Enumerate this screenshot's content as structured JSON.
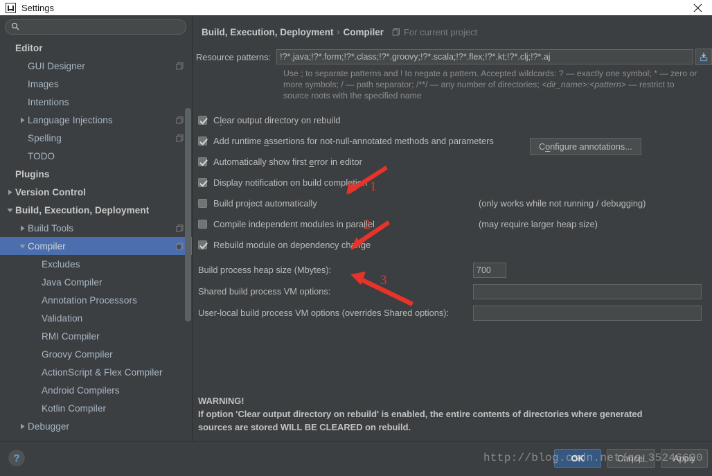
{
  "window": {
    "title": "Settings",
    "app_icon": "intellij-idea-icon",
    "close_icon": "close-icon"
  },
  "sidebar": {
    "search": {
      "value": "",
      "placeholder": "",
      "icon": "search-icon"
    },
    "items": [
      {
        "label": "Editor",
        "indent": 0,
        "bold": true,
        "twisty": "none",
        "copy": false,
        "selected": false
      },
      {
        "label": "GUI Designer",
        "indent": 1,
        "bold": false,
        "twisty": "none",
        "copy": true,
        "selected": false
      },
      {
        "label": "Images",
        "indent": 1,
        "bold": false,
        "twisty": "none",
        "copy": false,
        "selected": false
      },
      {
        "label": "Intentions",
        "indent": 1,
        "bold": false,
        "twisty": "none",
        "copy": false,
        "selected": false
      },
      {
        "label": "Language Injections",
        "indent": 1,
        "bold": false,
        "twisty": "collapsed",
        "copy": true,
        "selected": false
      },
      {
        "label": "Spelling",
        "indent": 1,
        "bold": false,
        "twisty": "none",
        "copy": true,
        "selected": false
      },
      {
        "label": "TODO",
        "indent": 1,
        "bold": false,
        "twisty": "none",
        "copy": false,
        "selected": false
      },
      {
        "label": "Plugins",
        "indent": 0,
        "bold": true,
        "twisty": "none",
        "copy": false,
        "selected": false
      },
      {
        "label": "Version Control",
        "indent": 0,
        "bold": true,
        "twisty": "collapsed",
        "copy": false,
        "selected": false
      },
      {
        "label": "Build, Execution, Deployment",
        "indent": 0,
        "bold": true,
        "twisty": "expanded",
        "copy": false,
        "selected": false
      },
      {
        "label": "Build Tools",
        "indent": 1,
        "bold": false,
        "twisty": "collapsed",
        "copy": true,
        "selected": false
      },
      {
        "label": "Compiler",
        "indent": 1,
        "bold": false,
        "twisty": "expanded",
        "copy": true,
        "selected": true
      },
      {
        "label": "Excludes",
        "indent": 2,
        "bold": false,
        "twisty": "none",
        "copy": false,
        "selected": false
      },
      {
        "label": "Java Compiler",
        "indent": 2,
        "bold": false,
        "twisty": "none",
        "copy": false,
        "selected": false
      },
      {
        "label": "Annotation Processors",
        "indent": 2,
        "bold": false,
        "twisty": "none",
        "copy": false,
        "selected": false
      },
      {
        "label": "Validation",
        "indent": 2,
        "bold": false,
        "twisty": "none",
        "copy": false,
        "selected": false
      },
      {
        "label": "RMI Compiler",
        "indent": 2,
        "bold": false,
        "twisty": "none",
        "copy": false,
        "selected": false
      },
      {
        "label": "Groovy Compiler",
        "indent": 2,
        "bold": false,
        "twisty": "none",
        "copy": false,
        "selected": false
      },
      {
        "label": "ActionScript & Flex Compiler",
        "indent": 2,
        "bold": false,
        "twisty": "none",
        "copy": false,
        "selected": false
      },
      {
        "label": "Android Compilers",
        "indent": 2,
        "bold": false,
        "twisty": "none",
        "copy": false,
        "selected": false
      },
      {
        "label": "Kotlin Compiler",
        "indent": 2,
        "bold": false,
        "twisty": "none",
        "copy": false,
        "selected": false
      },
      {
        "label": "Debugger",
        "indent": 1,
        "bold": false,
        "twisty": "collapsed",
        "copy": false,
        "selected": false
      }
    ]
  },
  "main": {
    "breadcrumb": {
      "path": "Build, Execution, Deployment",
      "separator": "›",
      "current": "Compiler",
      "scope_icon": "project-scope-icon",
      "scope_label": "For current project"
    },
    "resource_patterns": {
      "label": "Resource patterns:",
      "value": "!?*.java;!?*.form;!?*.class;!?*.groovy;!?*.scala;!?*.flex;!?*.kt;!?*.clj;!?*.aj",
      "browse_icon": "insert-pattern-icon",
      "hint_line1": "Use ; to separate patterns and ! to negate a pattern. Accepted wildcards: ? — exactly one symbol; * — zero or",
      "hint_line2_a": "more symbols; / — path separator; /**/ — any number of directories; ",
      "hint_line2_b": "<dir_name>:<pattern>",
      "hint_line2_c": " — restrict to source",
      "hint_line3": "roots with the specified name"
    },
    "checkboxes": [
      {
        "label_a": "C",
        "label_mn": "l",
        "label_b": "ear output directory on rebuild",
        "checked": true,
        "note": ""
      },
      {
        "label_a": "Add runtime ",
        "label_mn": "a",
        "label_b": "ssertions for not-null-annotated methods and parameters",
        "checked": true,
        "note": ""
      },
      {
        "label_a": "Automatically show first ",
        "label_mn": "e",
        "label_b": "rror in editor",
        "checked": true,
        "note": ""
      },
      {
        "label_a": "Display notification on build completion",
        "label_mn": "",
        "label_b": "",
        "checked": true,
        "note": ""
      },
      {
        "label_a": "Build project automatically",
        "label_mn": "",
        "label_b": "",
        "checked": false,
        "note": "(only works while not running / debugging)"
      },
      {
        "label_a": "Compile independent modules in parallel",
        "label_mn": "",
        "label_b": "",
        "checked": false,
        "note": "(may require larger heap size)"
      },
      {
        "label_a": "Rebuild module on dependency change",
        "label_mn": "",
        "label_b": "",
        "checked": true,
        "note": ""
      }
    ],
    "configure_annotations": {
      "label_a": "C",
      "label_mn": "o",
      "label_b": "nfigure annotations..."
    },
    "fields": [
      {
        "label": "Build process heap size (Mbytes):",
        "value": "700",
        "kind": "small"
      },
      {
        "label": "Shared build process VM options:",
        "value": "",
        "kind": "wide"
      },
      {
        "label": "User-local build process VM options (overrides Shared options):",
        "value": "",
        "kind": "wide"
      }
    ],
    "warning": {
      "title": "WARNING!",
      "line1": "If option 'Clear output directory on rebuild' is enabled, the entire contents of directories where generated",
      "line2": "sources are stored WILL BE CLEARED on rebuild."
    }
  },
  "footer": {
    "help_icon": "help-question-icon",
    "buttons": [
      {
        "label": "OK",
        "primary": true
      },
      {
        "label": "Cancel",
        "primary": false
      },
      {
        "label": "Apply",
        "primary": false
      }
    ]
  },
  "annotations": {
    "color": "#e8332a",
    "markers": [
      {
        "number": "1"
      },
      {
        "number": "2"
      },
      {
        "number": "3"
      }
    ]
  },
  "watermark": {
    "text": "http://blog.csdn.net/qq_35246620"
  }
}
